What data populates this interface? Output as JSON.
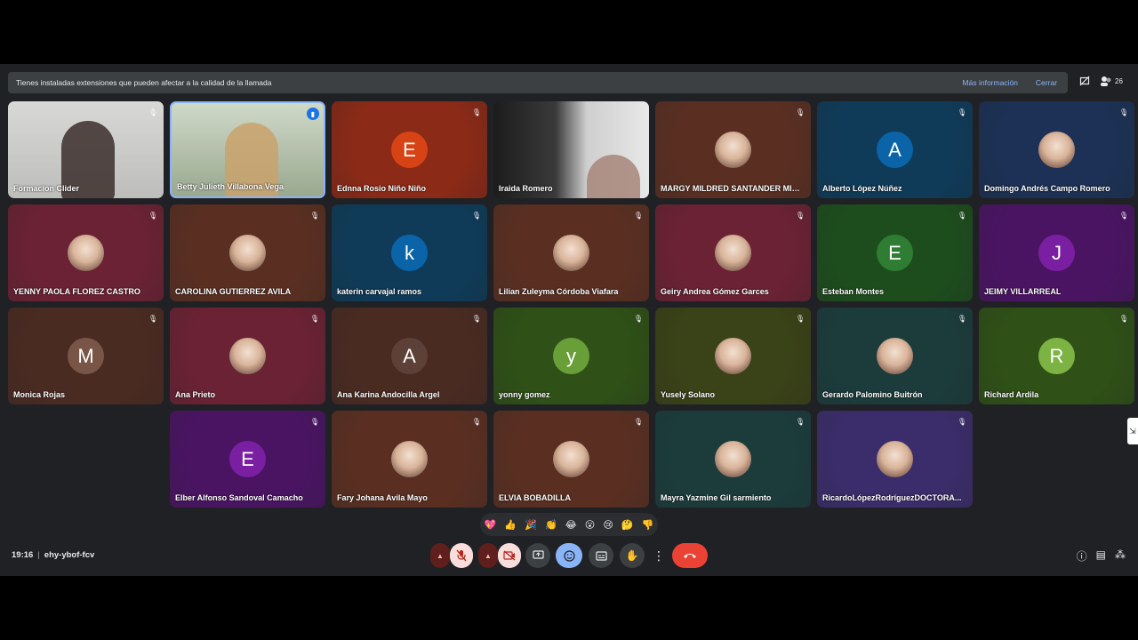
{
  "banner": {
    "message": "Tienes instaladas extensiones que pueden afectar a la calidad de la llamada",
    "more_info": "Más información",
    "close": "Cerrar"
  },
  "top": {
    "people_count": "26"
  },
  "meeting": {
    "time": "19:16",
    "code": "ehy-ybof-fcv"
  },
  "tiles": [
    {
      "name": "Formacion Clider",
      "kind": "video1",
      "mic": "muted"
    },
    {
      "name": "Betty Julieth Villabona Vega",
      "kind": "video2",
      "mic": "speaking"
    },
    {
      "name": "Ednna Rosio Niño Niño",
      "kind": "letter",
      "letter": "E",
      "bg": "#8b2a17",
      "avatar": "#d84315",
      "mic": "muted"
    },
    {
      "name": "Iraida Romero",
      "kind": "video3",
      "mic": "none"
    },
    {
      "name": "MARGY MILDRED SANTANDER MIEL...",
      "kind": "photo",
      "bg": "#5a2f22",
      "mic": "muted"
    },
    {
      "name": "Alberto López Núñez",
      "kind": "letter",
      "letter": "A",
      "bg": "#0f3b59",
      "avatar": "#0b64a8",
      "mic": "muted"
    },
    {
      "name": "Domingo Andrés Campo Romero",
      "kind": "photo",
      "bg": "#1c3155",
      "mic": "muted"
    },
    {
      "name": "YENNY PAOLA FLOREZ CASTRO",
      "kind": "photo",
      "bg": "#6b2234",
      "mic": "muted"
    },
    {
      "name": "CAROLINA GUTIERREZ AVILA",
      "kind": "photo",
      "bg": "#5a2f22",
      "mic": "muted"
    },
    {
      "name": "katerin carvajal ramos",
      "kind": "letter",
      "letter": "k",
      "bg": "#0f3b59",
      "avatar": "#0b64a8",
      "mic": "muted"
    },
    {
      "name": "Lilian Zuleyma Córdoba Viafara",
      "kind": "photo",
      "bg": "#5a2f22",
      "mic": "muted"
    },
    {
      "name": "Geiry Andrea Gómez Garces",
      "kind": "photo",
      "bg": "#6b2234",
      "mic": "muted"
    },
    {
      "name": "Esteban Montes",
      "kind": "letter",
      "letter": "E",
      "bg": "#1d4d1d",
      "avatar": "#2e7d32",
      "mic": "muted"
    },
    {
      "name": "JEIMY VILLARREAL",
      "kind": "letter",
      "letter": "J",
      "bg": "#4a1463",
      "avatar": "#7b1fa2",
      "mic": "muted"
    },
    {
      "name": "Monica Rojas",
      "kind": "letter",
      "letter": "M",
      "bg": "#4a2b22",
      "avatar": "#795548",
      "mic": "muted"
    },
    {
      "name": "Ana Prieto",
      "kind": "photo",
      "bg": "#6b2234",
      "mic": "muted"
    },
    {
      "name": "Ana Karina Andocilla Argel",
      "kind": "letter",
      "letter": "A",
      "bg": "#4a2b22",
      "avatar": "#5d4037",
      "mic": "muted"
    },
    {
      "name": "yonny gomez",
      "kind": "letter",
      "letter": "y",
      "bg": "#2f5017",
      "avatar": "#689f38",
      "mic": "muted"
    },
    {
      "name": "Yusely Solano",
      "kind": "photo",
      "bg": "#3a4217",
      "mic": "muted"
    },
    {
      "name": "Gerardo Palomino Buitrón",
      "kind": "photo",
      "bg": "#1c3c3c",
      "mic": "muted"
    },
    {
      "name": "Richard Ardila",
      "kind": "letter",
      "letter": "R",
      "bg": "#2f5017",
      "avatar": "#7cb342",
      "mic": "muted"
    },
    {
      "name": "Elber Alfonso Sandoval Camacho",
      "kind": "letter",
      "letter": "E",
      "bg": "#4a1463",
      "avatar": "#7b1fa2",
      "mic": "muted"
    },
    {
      "name": "Fary Johana Avila Mayo",
      "kind": "photo",
      "bg": "#5a2f22",
      "mic": "muted"
    },
    {
      "name": "ELVIA BOBADILLA",
      "kind": "photo",
      "bg": "#5a2f22",
      "mic": "muted"
    },
    {
      "name": "Mayra Yazmine Gil sarmiento",
      "kind": "photo",
      "bg": "#1c3c3c",
      "mic": "muted"
    },
    {
      "name": "RicardoLópezRodríguezDOCTORA...",
      "kind": "photo",
      "bg": "#3b2d6b",
      "mic": "muted"
    }
  ],
  "reactions": [
    "💖",
    "👍",
    "🎉",
    "👏",
    "😂",
    "😮",
    "😢",
    "🤔",
    "👎"
  ],
  "icons": {
    "mic_off": "mic-off-icon",
    "cam_off": "camera-off-icon",
    "present": "present-icon",
    "emoji": "emoji-icon",
    "captions": "captions-icon",
    "hand": "raise-hand-icon",
    "more": "more-icon",
    "end": "end-call-icon",
    "info": "info-icon",
    "chat": "chat-icon",
    "activities": "activities-icon"
  }
}
